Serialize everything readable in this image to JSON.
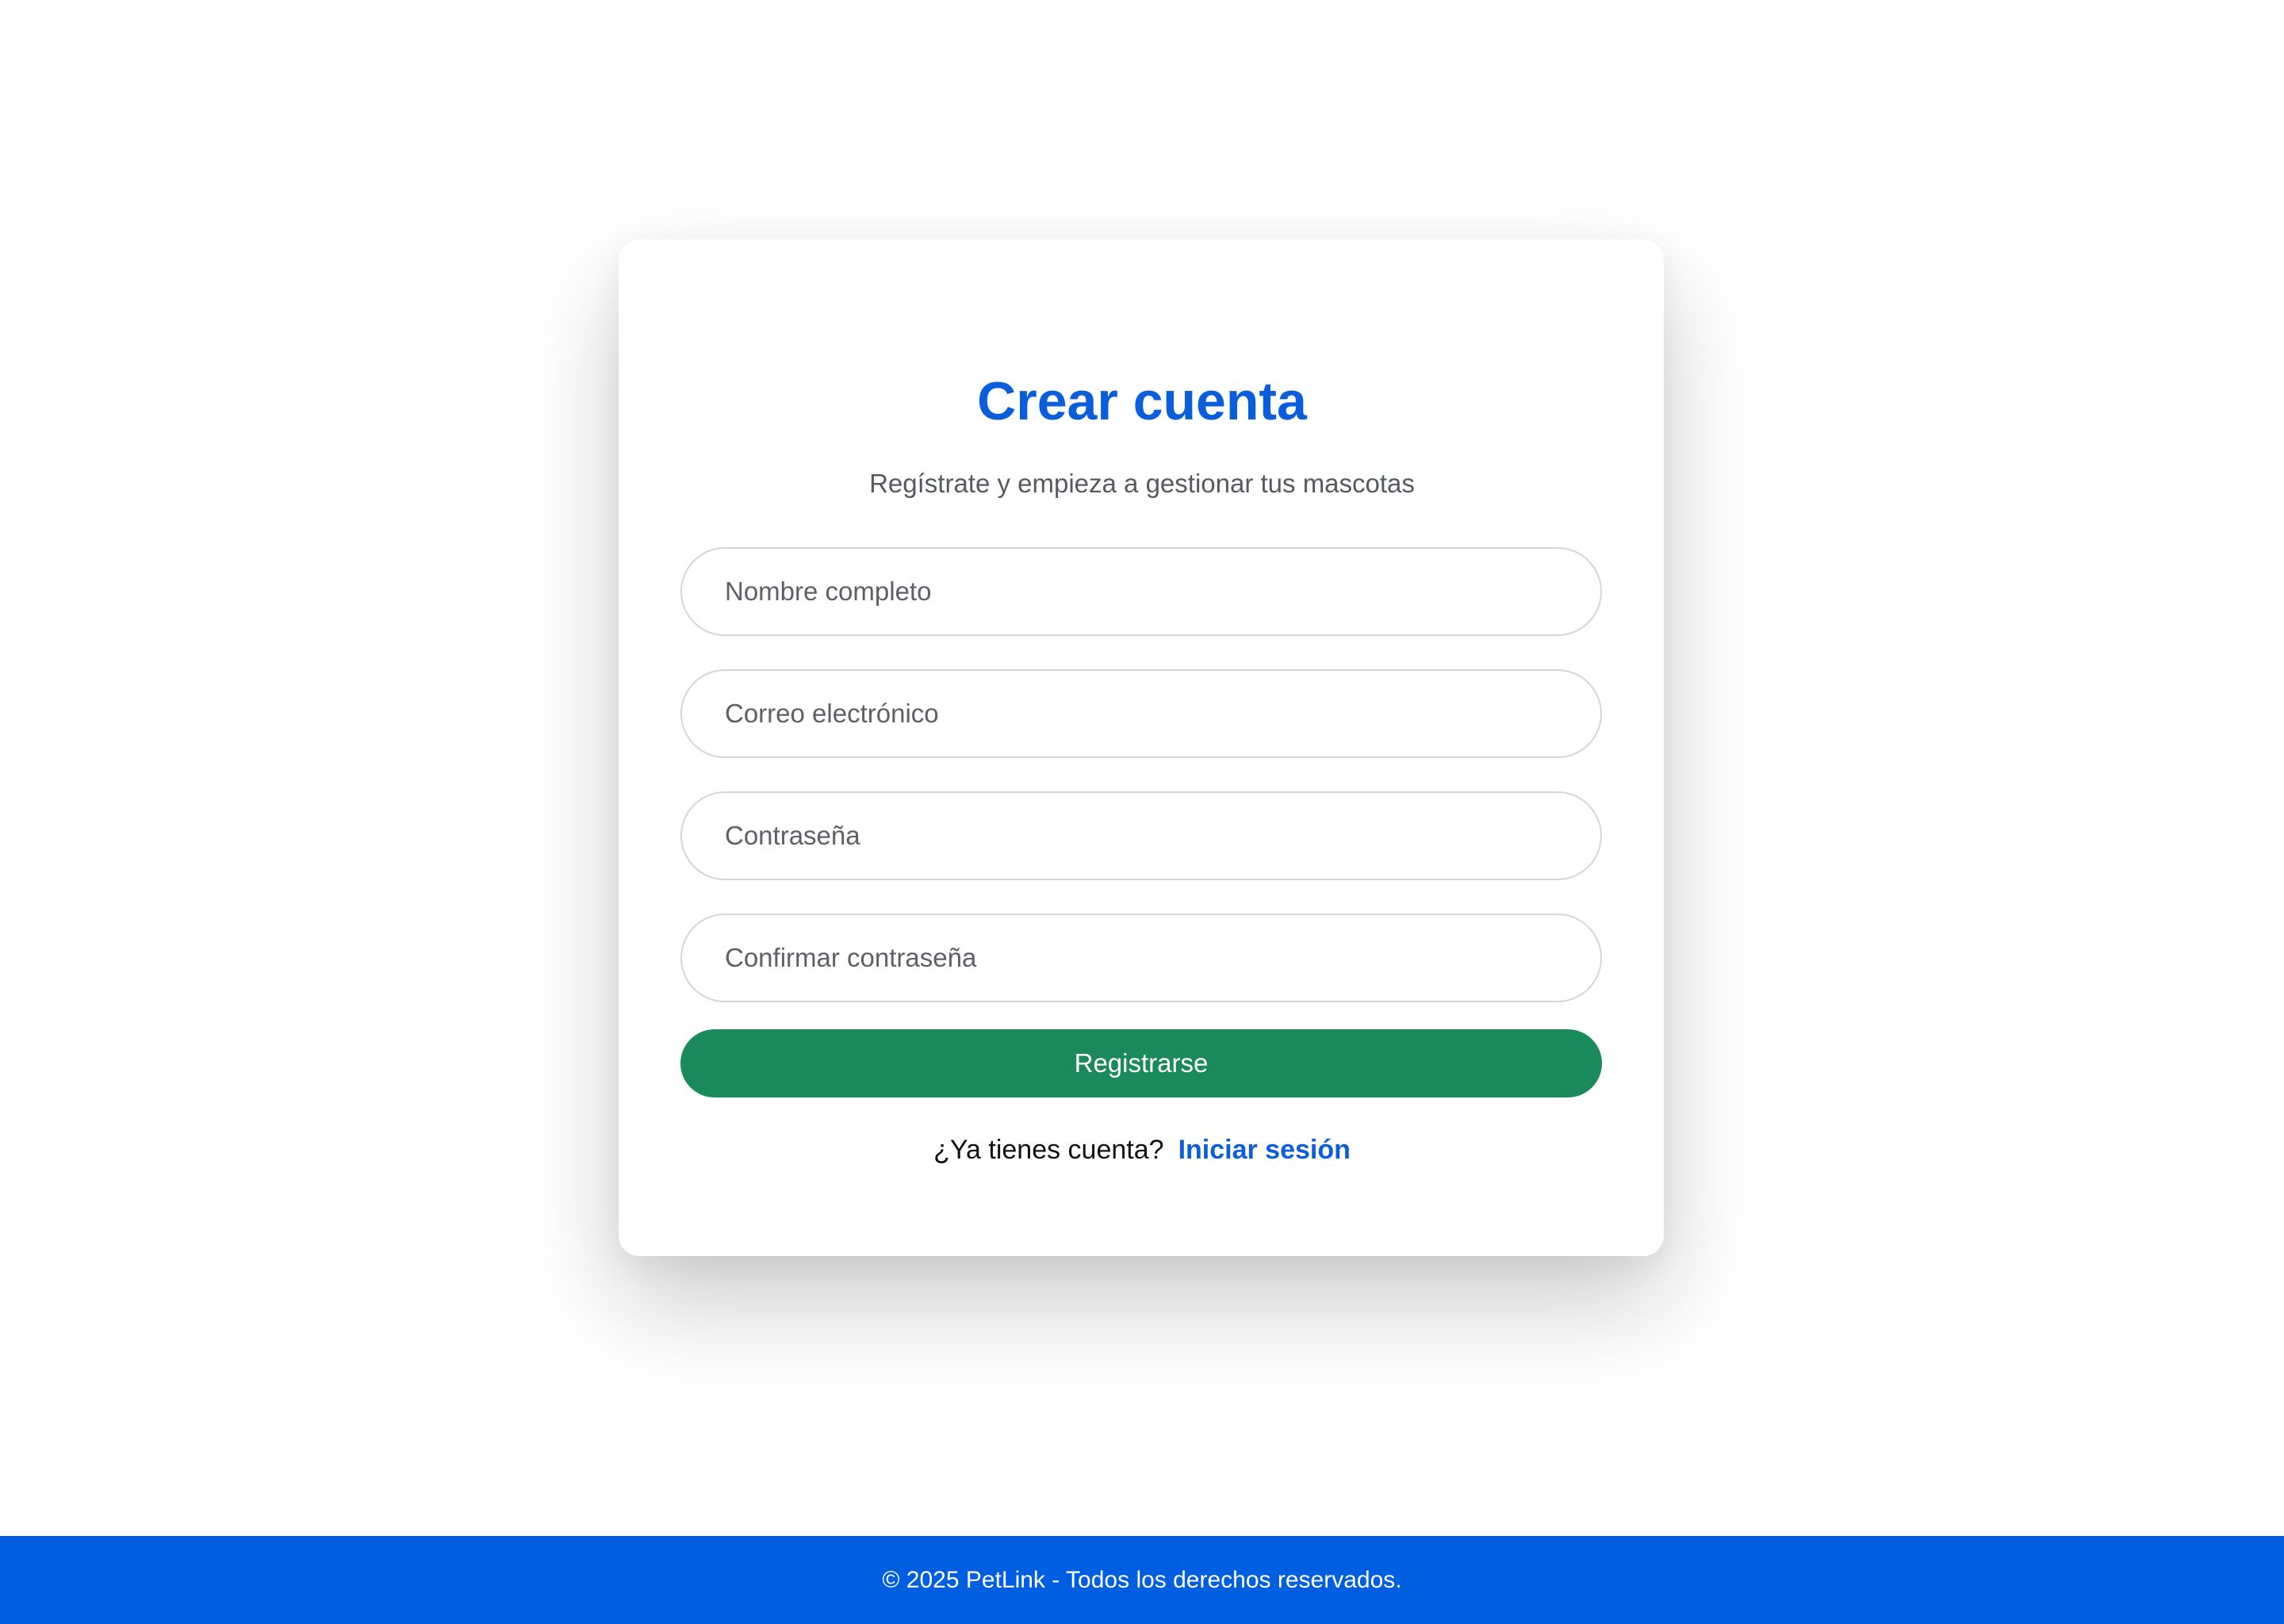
{
  "signup": {
    "title": "Crear cuenta",
    "subtitle": "Regístrate y empieza a gestionar tus mascotas",
    "fields": {
      "full_name": {
        "placeholder": "Nombre completo",
        "value": ""
      },
      "email": {
        "placeholder": "Correo electrónico",
        "value": ""
      },
      "password": {
        "placeholder": "Contraseña",
        "value": ""
      },
      "confirm_password": {
        "placeholder": "Confirmar contraseña",
        "value": ""
      }
    },
    "submit_label": "Registrarse",
    "login_prompt": "¿Ya tienes cuenta?",
    "login_link": "Iniciar sesión"
  },
  "footer": {
    "text": "© 2025 PetLink - Todos los derechos reservados."
  },
  "colors": {
    "primary_blue": "#0a5ddb",
    "footer_blue": "#005ee0",
    "button_green": "#1a8a5a",
    "subtitle_gray": "#555a60",
    "field_border": "#d4d6da"
  }
}
